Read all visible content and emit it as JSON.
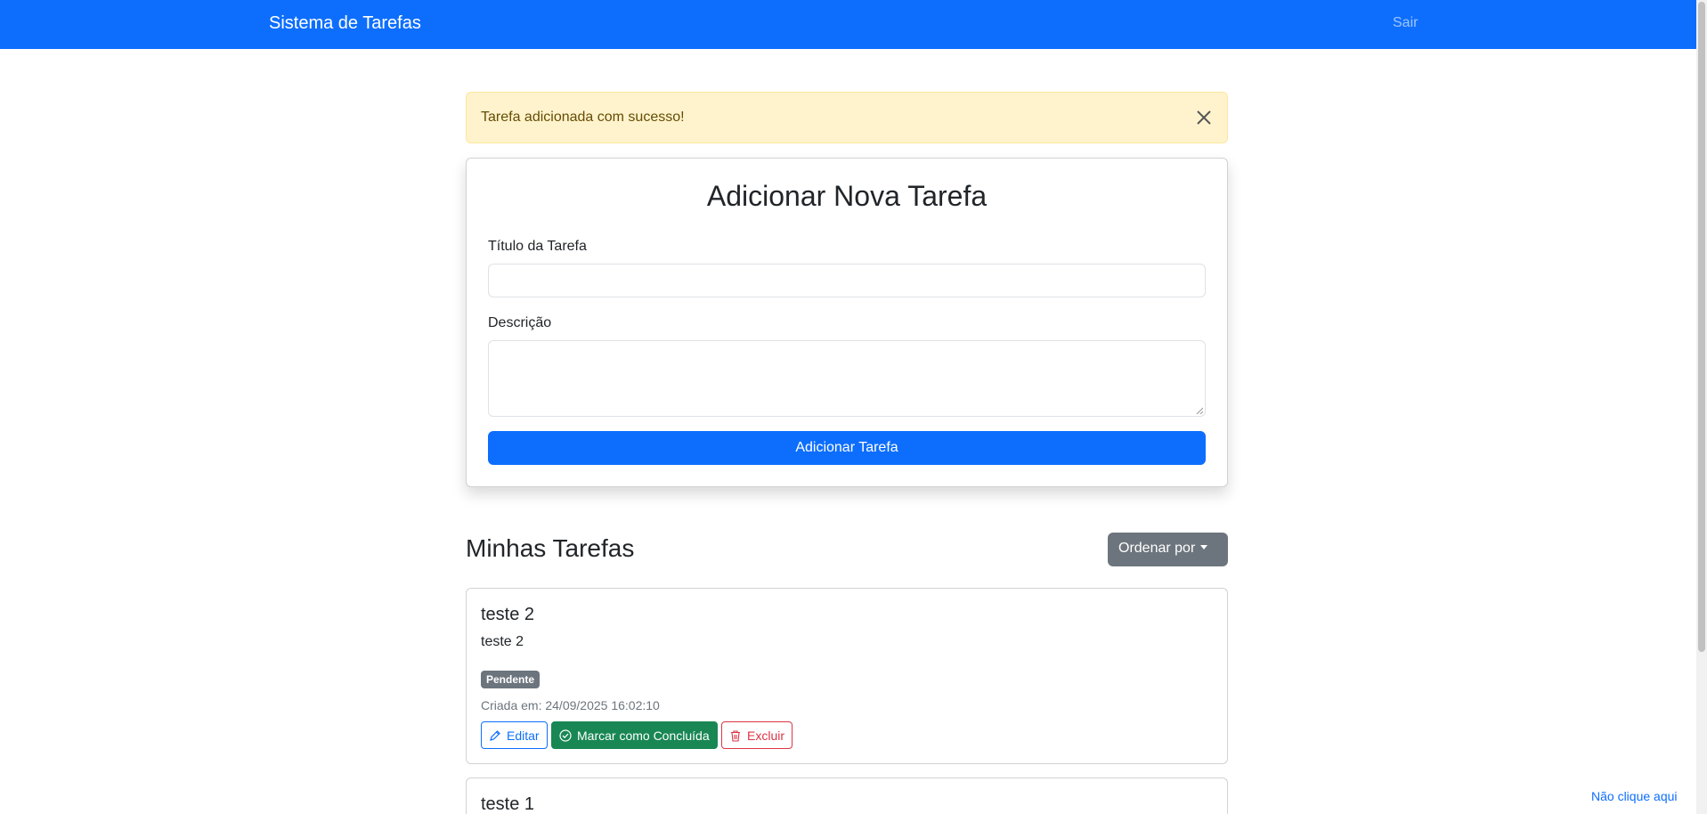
{
  "navbar": {
    "brand": "Sistema de Tarefas",
    "logout": "Sair"
  },
  "alert": {
    "message": "Tarefa adicionada com sucesso!",
    "close_icon": "close-icon"
  },
  "form": {
    "title": "Adicionar Nova Tarefa",
    "title_label": "Título da Tarefa",
    "title_value": "",
    "description_label": "Descrição",
    "description_value": "",
    "submit_label": "Adicionar Tarefa"
  },
  "tasks_section": {
    "title": "Minhas Tarefas",
    "sort_label": "Ordenar por"
  },
  "tasks": [
    {
      "title": "teste 2",
      "description": "teste 2",
      "status": "Pendente",
      "created": "Criada em: 24/09/2025 16:02:10",
      "edit_label": "Editar",
      "done_label": "Marcar como Concluída",
      "delete_label": "Excluir"
    },
    {
      "title": "teste 1"
    }
  ],
  "footer": {
    "link": "Não clique aqui"
  },
  "colors": {
    "primary": "#0d6efd",
    "success": "#198754",
    "danger": "#dc3545",
    "secondary": "#6c757d",
    "alert_bg": "#fff3cd"
  }
}
